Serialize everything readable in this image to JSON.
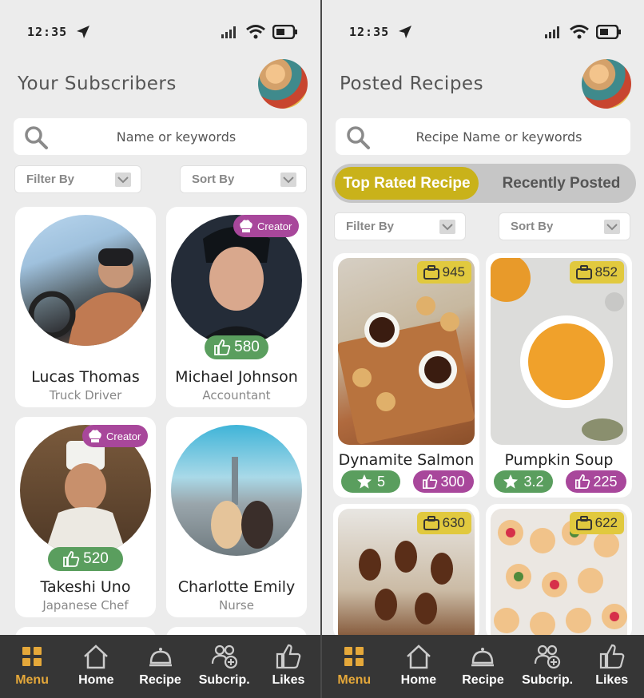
{
  "status": {
    "time": "12:35"
  },
  "left": {
    "title": "Your Subscribers",
    "search_placeholder": "Name or keywords",
    "filter_label": "Filter By",
    "sort_label": "Sort By",
    "subscribers": [
      {
        "name": "Lucas Thomas",
        "role": "Truck Driver"
      },
      {
        "name": "Michael Johnson",
        "role": "Accountant",
        "badge": "Creator",
        "likes": "580"
      },
      {
        "name": "Takeshi Uno",
        "role": "Japanese Chef",
        "badge": "Creator",
        "likes": "520"
      },
      {
        "name": "Charlotte Emily",
        "role": "Nurse"
      }
    ]
  },
  "right": {
    "title": "Posted Recipes",
    "search_placeholder": "Recipe Name or keywords",
    "tabs": [
      "Top Rated Recipe",
      "Recently Posted"
    ],
    "filter_label": "Filter By",
    "sort_label": "Sort By",
    "recipes": [
      {
        "name": "Dynamite Salmon",
        "views": "945",
        "rating": "5",
        "likes": "300"
      },
      {
        "name": "Pumpkin Soup",
        "views": "852",
        "rating": "3.2",
        "likes": "225"
      },
      {
        "views": "630"
      },
      {
        "views": "622"
      }
    ]
  },
  "nav": [
    {
      "label": "Menu",
      "icon": "grid-icon"
    },
    {
      "label": "Home",
      "icon": "home-icon"
    },
    {
      "label": "Recipe",
      "icon": "cloche-icon"
    },
    {
      "label": "Subcrip.",
      "icon": "users-add-icon"
    },
    {
      "label": "Likes",
      "icon": "thumbs-up-icon"
    }
  ],
  "colors": {
    "accent": "#e5a83a",
    "gold": "#c9b21a",
    "green": "#5a9e5e",
    "purple": "#a8479b"
  }
}
